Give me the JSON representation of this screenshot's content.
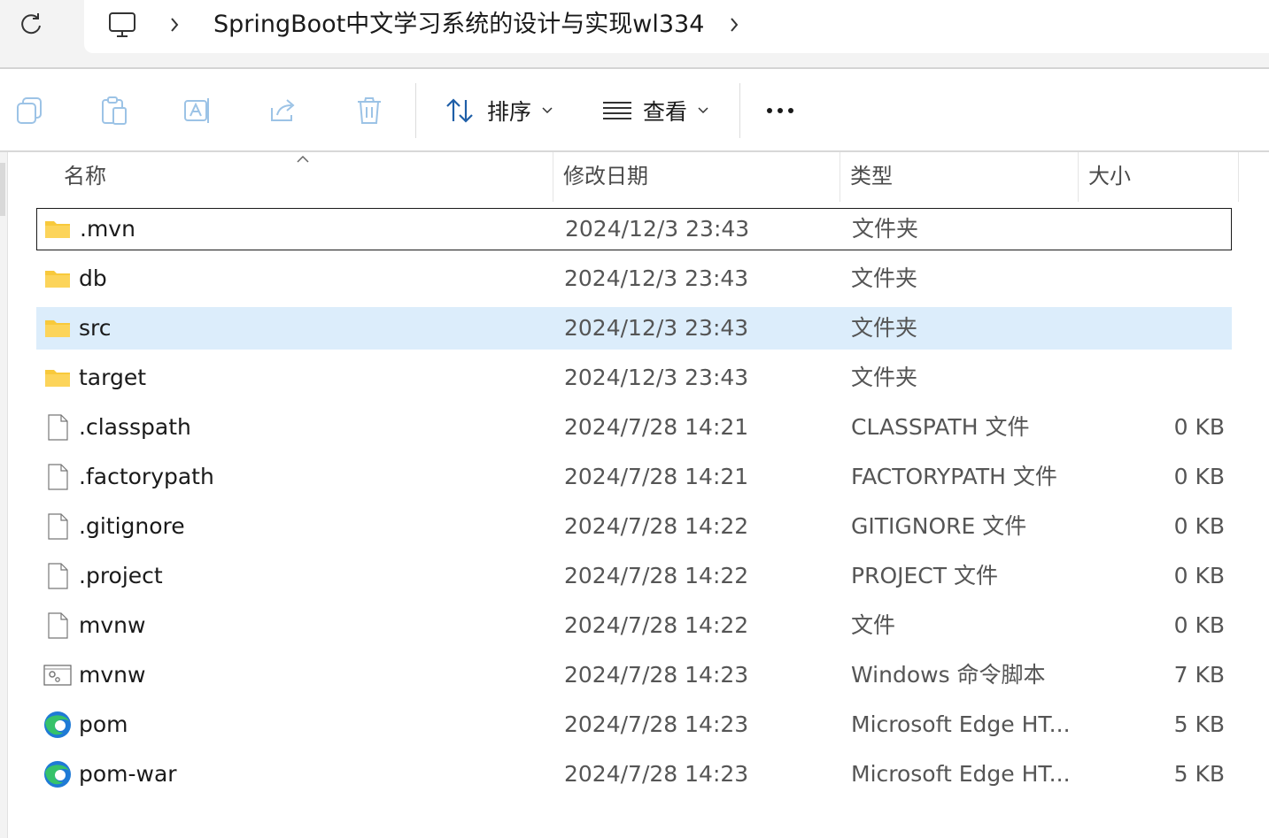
{
  "address_bar": {
    "path": "SpringBoot中文学习系统的设计与实现wl334",
    "separator": "›"
  },
  "toolbar": {
    "sort_label": "排序",
    "view_label": "查看"
  },
  "columns": {
    "name": "名称",
    "date": "修改日期",
    "type": "类型",
    "size": "大小"
  },
  "files": [
    {
      "icon": "folder-icon",
      "name": ".mvn",
      "date": "2024/12/3 23:43",
      "type": "文件夹",
      "size": ""
    },
    {
      "icon": "folder-icon",
      "name": "db",
      "date": "2024/12/3 23:43",
      "type": "文件夹",
      "size": ""
    },
    {
      "icon": "folder-icon",
      "name": "src",
      "date": "2024/12/3 23:43",
      "type": "文件夹",
      "size": ""
    },
    {
      "icon": "folder-icon",
      "name": "target",
      "date": "2024/12/3 23:43",
      "type": "文件夹",
      "size": ""
    },
    {
      "icon": "file-icon",
      "name": ".classpath",
      "date": "2024/7/28 14:21",
      "type": "CLASSPATH 文件",
      "size": "0 KB"
    },
    {
      "icon": "file-icon",
      "name": ".factorypath",
      "date": "2024/7/28 14:21",
      "type": "FACTORYPATH 文件",
      "size": "0 KB"
    },
    {
      "icon": "file-icon",
      "name": ".gitignore",
      "date": "2024/7/28 14:22",
      "type": "GITIGNORE 文件",
      "size": "0 KB"
    },
    {
      "icon": "file-icon",
      "name": ".project",
      "date": "2024/7/28 14:22",
      "type": "PROJECT 文件",
      "size": "0 KB"
    },
    {
      "icon": "file-icon",
      "name": "mvnw",
      "date": "2024/7/28 14:22",
      "type": "文件",
      "size": "0 KB"
    },
    {
      "icon": "script-icon",
      "name": "mvnw",
      "date": "2024/7/28 14:23",
      "type": "Windows 命令脚本",
      "size": "7 KB"
    },
    {
      "icon": "edge-icon",
      "name": "pom",
      "date": "2024/7/28 14:23",
      "type": "Microsoft Edge HT...",
      "size": "5 KB"
    },
    {
      "icon": "edge-icon",
      "name": "pom-war",
      "date": "2024/7/28 14:23",
      "type": "Microsoft Edge HT...",
      "size": "5 KB"
    }
  ],
  "state": {
    "focused_row": 0,
    "selected_row": 2
  },
  "colors": {
    "selection": "#dcedfb",
    "folder": "#f8c93b",
    "edge_blue": "#1f7ad6",
    "edge_green": "#36c26b"
  }
}
